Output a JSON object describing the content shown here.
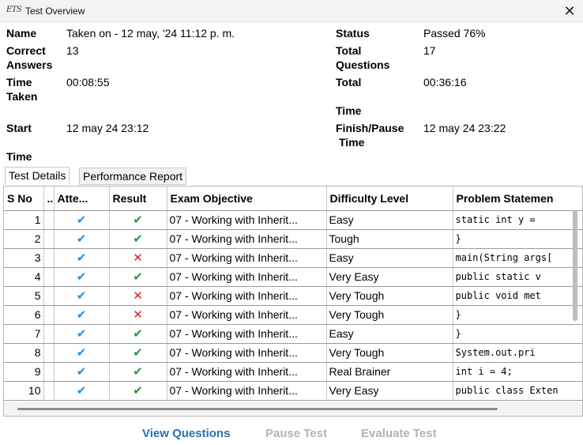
{
  "window": {
    "title": "Test Overview",
    "logo_text": "ETS"
  },
  "summary": {
    "name_label": "Name",
    "name_value": "Taken on - 12 may, '24 11:12 p. m.",
    "status_label": "Status",
    "status_value": "Passed 76%",
    "correct_label_1": "Correct",
    "correct_label_2": "Answers",
    "correct_value": "13",
    "total_q_label_1": "Total",
    "total_q_label_2": "Questions",
    "total_q_value": "17",
    "time_taken_label_1": "Time",
    "time_taken_label_2": "Taken",
    "time_taken_value": "00:08:55",
    "total_time_label_1": "Total",
    "total_time_label_2": "Time",
    "total_time_value": "00:36:16",
    "start_label_1": "Start",
    "start_label_2": "Time",
    "start_value": "12 may 24 23:12",
    "finish_label_1": "Finish/Pause",
    "finish_label_2": "Time",
    "finish_value": "12 may 24 23:22"
  },
  "tabs": [
    {
      "label": "Test Details",
      "active": true
    },
    {
      "label": "Performance Report",
      "active": false
    }
  ],
  "table": {
    "headers": [
      "S No",
      "..",
      "Atte...",
      "Result",
      "Exam Objective",
      "Difficulty Level",
      "Problem Statemen"
    ],
    "rows": [
      {
        "sno": "1",
        "attempted": "check",
        "result": "correct",
        "objective": "07 - Working with Inherit...",
        "difficulty": "Easy",
        "problem": "  static int y ="
      },
      {
        "sno": "2",
        "attempted": "check",
        "result": "correct",
        "objective": "07 - Working with Inherit...",
        "difficulty": "Tough",
        "problem": "  }"
      },
      {
        "sno": "3",
        "attempted": "check",
        "result": "wrong",
        "objective": "07 - Working with Inherit...",
        "difficulty": "Easy",
        "problem": "main(String args["
      },
      {
        "sno": "4",
        "attempted": "check",
        "result": "correct",
        "objective": "07 - Working with Inherit...",
        "difficulty": "Very Easy",
        "problem": "  public static v"
      },
      {
        "sno": "5",
        "attempted": "check",
        "result": "wrong",
        "objective": "07 - Working with Inherit...",
        "difficulty": "Very Tough",
        "problem": "  public void met"
      },
      {
        "sno": "6",
        "attempted": "check",
        "result": "wrong",
        "objective": "07 - Working with Inherit...",
        "difficulty": "Very Tough",
        "problem": "}"
      },
      {
        "sno": "7",
        "attempted": "check",
        "result": "correct",
        "objective": "07 - Working with Inherit...",
        "difficulty": "Easy",
        "problem": "}"
      },
      {
        "sno": "8",
        "attempted": "check",
        "result": "correct",
        "objective": "07 - Working with Inherit...",
        "difficulty": "Very Tough",
        "problem": "   System.out.pri"
      },
      {
        "sno": "9",
        "attempted": "check",
        "result": "correct",
        "objective": "07 - Working with Inherit...",
        "difficulty": "Real Brainer",
        "problem": "  int i =   4;"
      },
      {
        "sno": "10",
        "attempted": "check",
        "result": "correct",
        "objective": "07 - Working with Inherit...",
        "difficulty": "Very Easy",
        "problem": "public class Exten"
      }
    ]
  },
  "icons": {
    "attempted": "✔",
    "correct": "✔",
    "wrong": "✕",
    "close": "✕"
  },
  "colors": {
    "attempted": "#1e90e6",
    "correct": "#1f9a3a",
    "wrong": "#e02020",
    "link": "#2a6fb5",
    "disabled": "#b3b3b3"
  },
  "actions": {
    "view": "View Questions",
    "pause": "Pause Test",
    "evaluate": "Evaluate Test"
  }
}
